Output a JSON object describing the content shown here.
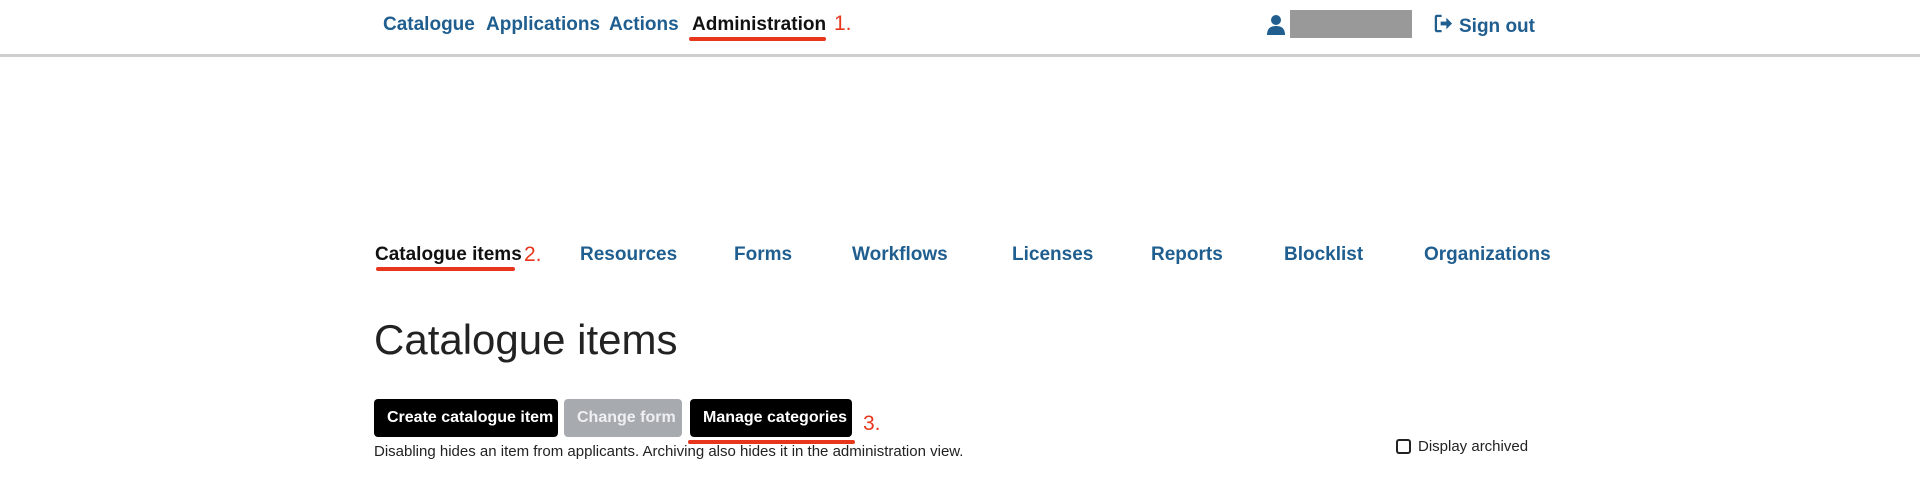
{
  "navbar": {
    "links": [
      {
        "label": "Catalogue",
        "active": false
      },
      {
        "label": "Applications",
        "active": false
      },
      {
        "label": "Actions",
        "active": false
      },
      {
        "label": "Administration",
        "active": true
      }
    ],
    "user_icon": "user-icon",
    "sign_out_icon": "sign-out-icon",
    "sign_out_label": "Sign out"
  },
  "annotations": {
    "one": "1.",
    "two": "2.",
    "three": "3."
  },
  "tabs": [
    {
      "label": "Catalogue items",
      "active": true
    },
    {
      "label": "Resources",
      "active": false
    },
    {
      "label": "Forms",
      "active": false
    },
    {
      "label": "Workflows",
      "active": false
    },
    {
      "label": "Licenses",
      "active": false
    },
    {
      "label": "Reports",
      "active": false
    },
    {
      "label": "Blocklist",
      "active": false
    },
    {
      "label": "Organizations",
      "active": false
    }
  ],
  "page": {
    "title": "Catalogue items",
    "buttons": {
      "create": "Create catalogue item",
      "change_form": "Change form",
      "manage_categories": "Manage categories"
    },
    "help_text": "Disabling hides an item from applicants. Archiving also hides it in the administration view.",
    "display_archived_label": "Display archived",
    "display_archived_checked": false
  },
  "colors": {
    "link": "#1f5e8f",
    "annotation": "#e8361c",
    "button_dark": "#000000",
    "button_disabled": "#a7abb0"
  }
}
